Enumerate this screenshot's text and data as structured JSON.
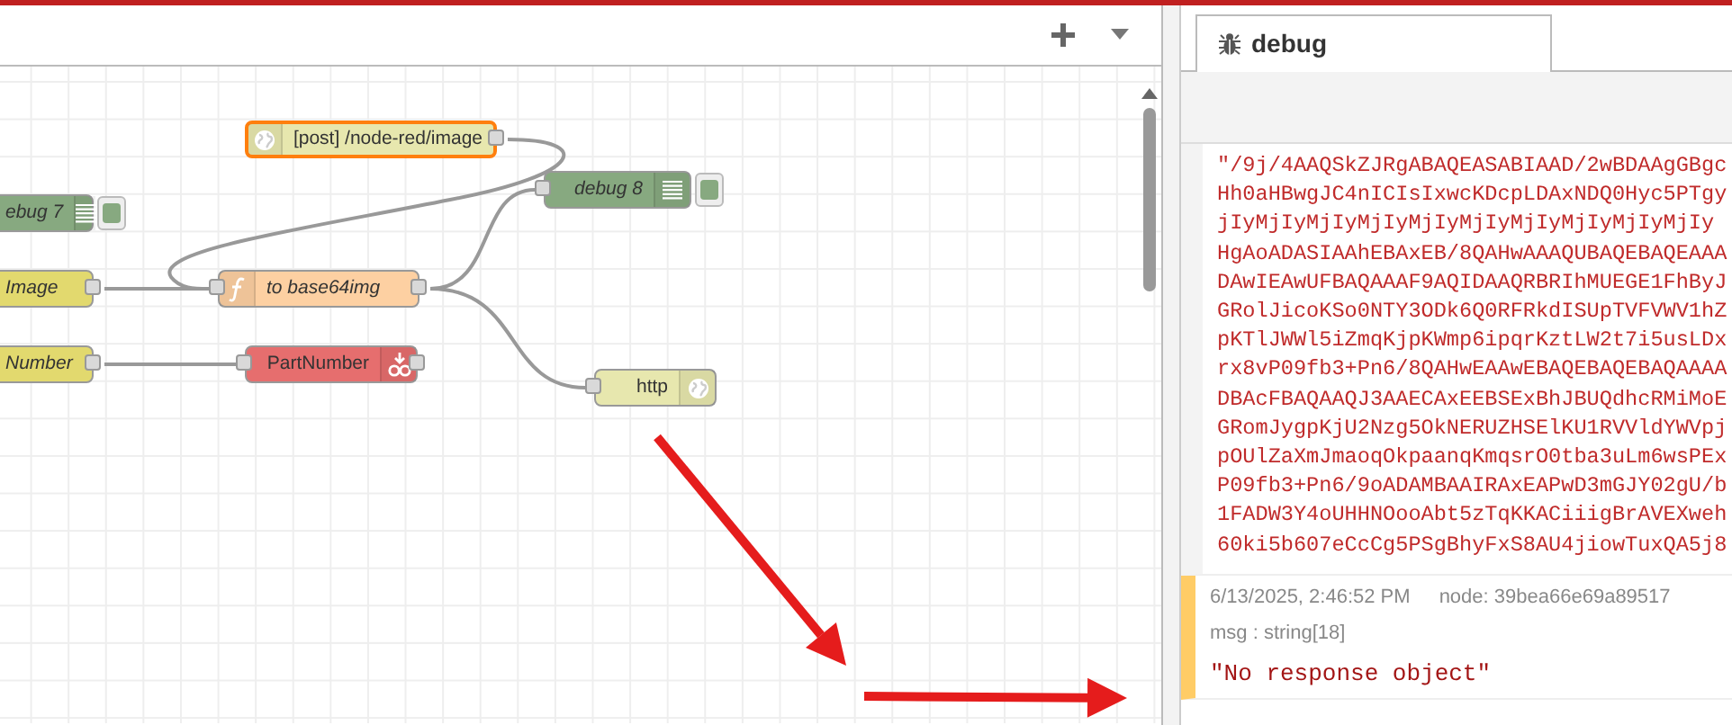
{
  "workspace": {
    "nodes": [
      {
        "label": "[post] /node-red/image",
        "kind": "http-in",
        "italic": false,
        "selected": true
      },
      {
        "label": "ebug 7",
        "kind": "debug",
        "italic": true,
        "selected": false
      },
      {
        "label": "Image",
        "kind": "change",
        "italic": true,
        "selected": false
      },
      {
        "label": "to base64img",
        "kind": "function",
        "italic": true,
        "selected": false
      },
      {
        "label": "debug 8",
        "kind": "debug",
        "italic": true,
        "selected": false
      },
      {
        "label": "Number",
        "kind": "change",
        "italic": true,
        "selected": false
      },
      {
        "label": "PartNumber",
        "kind": "store",
        "italic": false,
        "selected": false
      },
      {
        "label": "http",
        "kind": "http-response",
        "italic": false,
        "selected": false
      }
    ]
  },
  "sidebar": {
    "tab": {
      "label": "debug",
      "selected": true
    },
    "messages": [
      {
        "selected": false,
        "lines": [
          "\"/9j/4AAQSkZJRgABAQEASABIAAD/2wBDAAgGBgc",
          "Hh0aHBwgJC4nICIsIxwcKDcpLDAxNDQ0Hyc5PTgy",
          "jIyMjIyMjIyMjIyMjIyMjIyMjIyMjIyMjIyMjIy",
          "HgAoADASIAAhEBAxEB/8QAHwAAAQUBAQEBAQEAAA",
          "DAwIEAwUFBAQAAAF9AQIDAAQRBRIhMUEGE1FhByJ",
          "GRolJicoKSo0NTY3ODk6Q0RFRkdISUpTVFVWV1hZ",
          "pKTlJWWl5iZmqKjpKWmp6ipqrKztLW2t7i5usLDx",
          "rx8vP09fb3+Pn6/8QAHwEAAwEBAQEBAQEBAQAAAA",
          "DBAcFBAQAAQJ3AAECAxEEBSExBhJBUQdhcRMiMoE",
          "GRomJygpKjU2Nzg5OkNERUZHSElKU1RVVldYWVpj",
          "pOUlZaXmJmaoqOkpaanqKmqsrO0tba3uLm6wsPEx",
          "P09fb3+Pn6/9oADAMBAAIRAxEAPwD3mGJY02gU/b",
          "1FADW3Y4oUHHNOooAbt5zTqKKACiiigBrAVEXweh",
          "60ki5b607eCcCg5PSgBhyFxS8AU4jiowTuxQA5j8"
        ]
      },
      {
        "selected": true,
        "time": "6/13/2025, 2:46:52 PM",
        "node": "node: 39bea66e69a89517",
        "type": "msg : string[18]",
        "lines": [
          "\"No response object\""
        ]
      }
    ]
  }
}
